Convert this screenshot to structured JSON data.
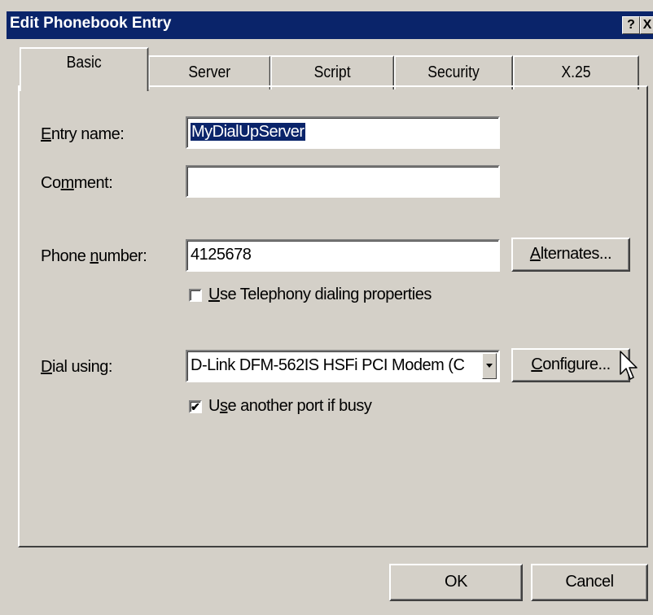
{
  "window": {
    "title": "Edit Phonebook Entry",
    "help_glyph": "?",
    "close_glyph": "X"
  },
  "tabs": [
    {
      "label": "Basic",
      "active": true
    },
    {
      "label": "Server",
      "active": false
    },
    {
      "label": "Script",
      "active": false
    },
    {
      "label": "Security",
      "active": false
    },
    {
      "label": "X.25",
      "active": false
    }
  ],
  "form": {
    "entry_name": {
      "label_pre": "",
      "label_accel": "E",
      "label_post": "ntry name:",
      "value": "MyDialUpServer"
    },
    "comment": {
      "label_pre": "Co",
      "label_accel": "m",
      "label_post": "ment:",
      "value": ""
    },
    "phone_number": {
      "label_pre": "Phone ",
      "label_accel": "n",
      "label_post": "umber:",
      "value": "4125678"
    },
    "alternates_button": {
      "label_pre": "",
      "label_accel": "A",
      "label_post": "lternates..."
    },
    "use_telephony": {
      "label_pre": "",
      "label_accel": "U",
      "label_post": "se Telephony dialing properties",
      "checked": false
    },
    "dial_using": {
      "label_pre": "",
      "label_accel": "D",
      "label_post": "ial using:",
      "value": "D-Link DFM-562IS HSFi PCI Modem (C"
    },
    "configure_button": {
      "label_pre": "",
      "label_accel": "C",
      "label_post": "onfigure..."
    },
    "use_another_port": {
      "label_pre": "U",
      "label_accel": "s",
      "label_post": "e another port if busy",
      "checked": true,
      "check_glyph": "✔"
    }
  },
  "footer": {
    "ok_label": "OK",
    "cancel_label": "Cancel"
  }
}
